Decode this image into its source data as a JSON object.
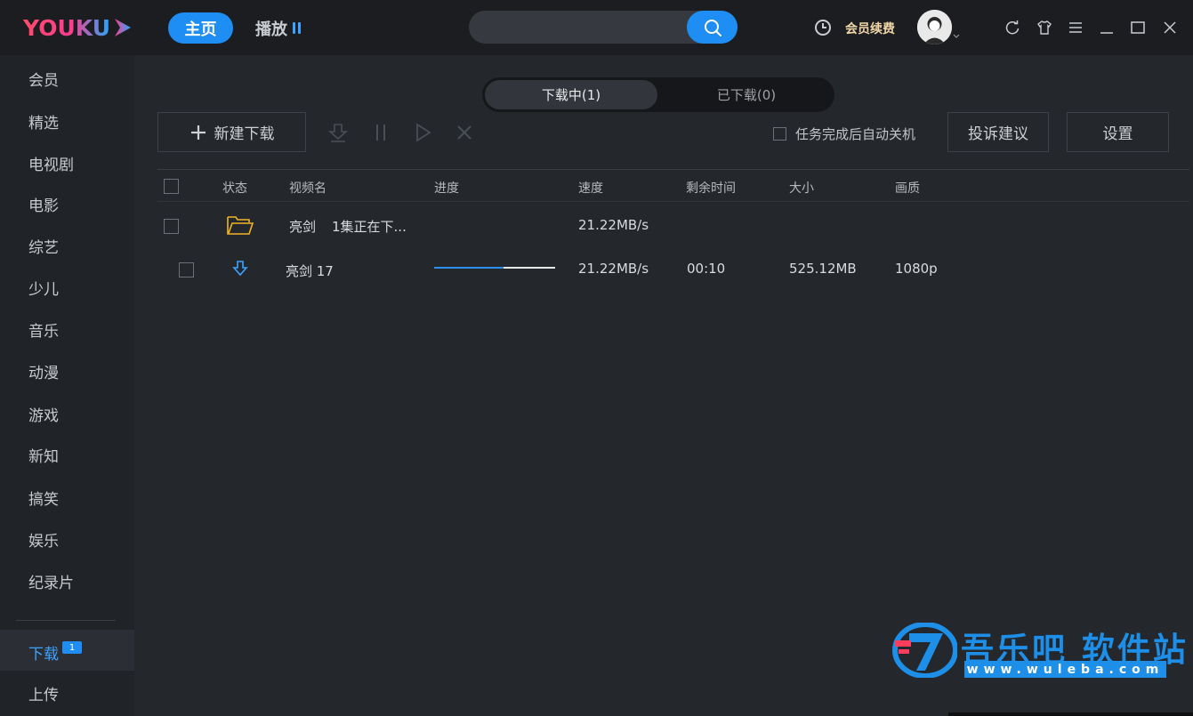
{
  "app": {
    "logo_text": "YOUKU",
    "brand_colors": {
      "accent": "#1e8ef5",
      "logo_pink": "#ff3d7a",
      "logo_blue": "#21a7ff"
    }
  },
  "topbar": {
    "home_tab": "主页",
    "play_tab": "播放",
    "search": {
      "value": "",
      "placeholder": ""
    },
    "vip_renew": "会员续费",
    "icons": [
      "history-icon",
      "refresh-icon",
      "skin-icon",
      "menu-icon",
      "minimize-icon",
      "maximize-icon",
      "close-icon"
    ]
  },
  "sidebar": {
    "items": [
      {
        "label": "会员"
      },
      {
        "label": "精选"
      },
      {
        "label": "电视剧"
      },
      {
        "label": "电影"
      },
      {
        "label": "综艺"
      },
      {
        "label": "少儿"
      },
      {
        "label": "音乐"
      },
      {
        "label": "动漫"
      },
      {
        "label": "游戏"
      },
      {
        "label": "新知"
      },
      {
        "label": "搞笑"
      },
      {
        "label": "娱乐"
      },
      {
        "label": "纪录片"
      }
    ],
    "download": {
      "label": "下载",
      "badge": "1"
    },
    "upload": {
      "label": "上传"
    }
  },
  "main": {
    "tabs": {
      "downloading": "下载中(1)",
      "downloaded": "已下载(0)"
    },
    "new_download": "新建下载",
    "auto_shutdown": "任务完成后自动关机",
    "feedback": "投诉建议",
    "settings": "设置",
    "columns": [
      "状态",
      "视频名",
      "进度",
      "速度",
      "剩余时间",
      "大小",
      "画质"
    ],
    "group_row": {
      "name": "亮剑",
      "status_text": "1集正在下...",
      "speed": "21.22MB/s"
    },
    "item_row": {
      "name": "亮剑 17",
      "progress": 0.57,
      "speed": "21.22MB/s",
      "remaining": "00:10",
      "size": "525.12MB",
      "quality": "1080p"
    }
  },
  "watermark": {
    "title": "吾乐吧 软件站",
    "url": "www.wuleba.com"
  }
}
